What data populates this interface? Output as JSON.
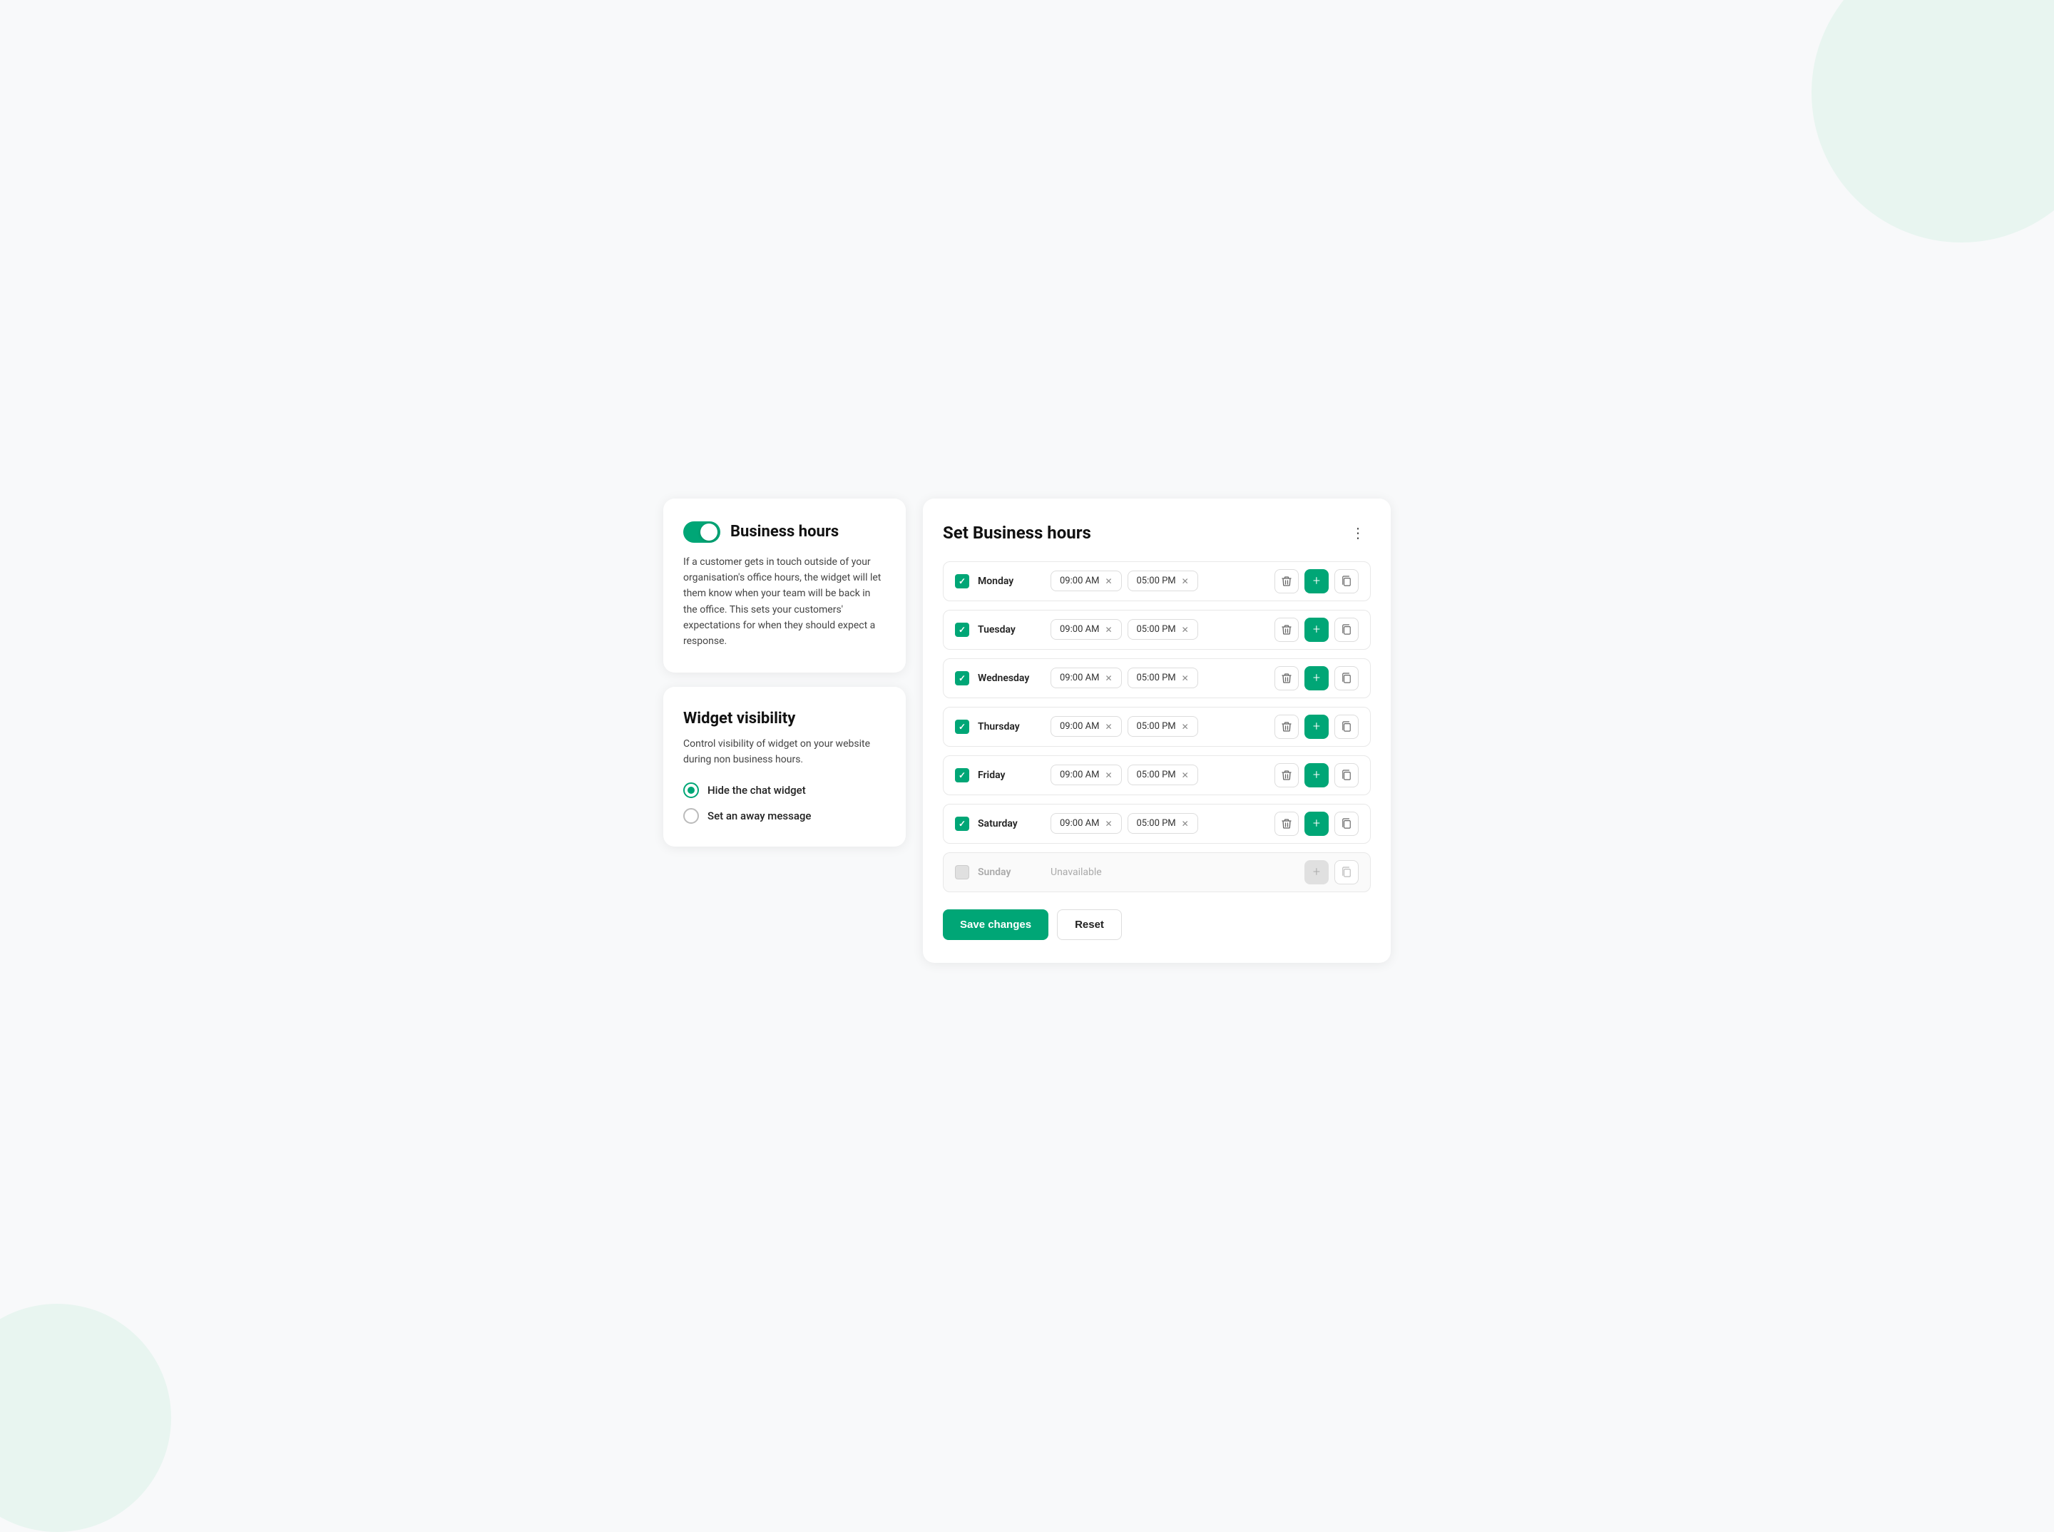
{
  "background": {
    "circle_color": "#e8f5f0"
  },
  "business_hours_card": {
    "title": "Business hours",
    "toggle_on": true,
    "description": "If a customer gets in touch outside of your organisation's office hours, the widget will let them know when your team will be back in the office. This sets your customers' expectations for when they should expect a response."
  },
  "widget_visibility_card": {
    "title": "Widget visibility",
    "description": "Control visibility of widget on your website during non business hours.",
    "options": [
      {
        "label": "Hide the chat widget",
        "checked": true
      },
      {
        "label": "Set an away message",
        "checked": false
      }
    ]
  },
  "business_hours_panel": {
    "title": "Set Business hours",
    "menu_icon": "⋮",
    "days": [
      {
        "name": "Monday",
        "enabled": true,
        "slots": [
          {
            "start": "09:00 AM",
            "end": "05:00 PM"
          }
        ]
      },
      {
        "name": "Tuesday",
        "enabled": true,
        "slots": [
          {
            "start": "09:00 AM",
            "end": "05:00 PM"
          }
        ]
      },
      {
        "name": "Wednesday",
        "enabled": true,
        "slots": [
          {
            "start": "09:00 AM",
            "end": "05:00 PM"
          }
        ]
      },
      {
        "name": "Thursday",
        "enabled": true,
        "slots": [
          {
            "start": "09:00 AM",
            "end": "05:00 PM"
          }
        ]
      },
      {
        "name": "Friday",
        "enabled": true,
        "slots": [
          {
            "start": "09:00 AM",
            "end": "05:00 PM"
          }
        ]
      },
      {
        "name": "Saturday",
        "enabled": true,
        "slots": [
          {
            "start": "09:00 AM",
            "end": "05:00 PM"
          }
        ]
      },
      {
        "name": "Sunday",
        "enabled": false,
        "slots": [],
        "unavailable_text": "Unavailable"
      }
    ],
    "save_button_label": "Save changes",
    "reset_button_label": "Reset"
  }
}
